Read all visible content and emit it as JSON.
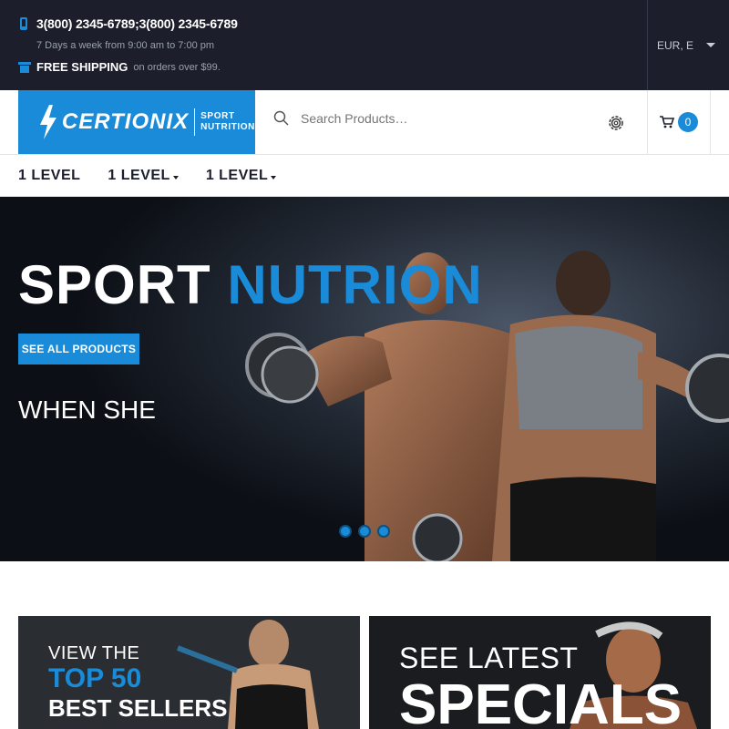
{
  "topbar": {
    "phone": "3(800) 2345-6789;3(800) 2345-6789",
    "hours": "7 Days a week from 9:00 am to 7:00 pm",
    "shipping_label": "FREE SHIPPING",
    "shipping_note": "on orders over $99.",
    "currency": "EUR, E"
  },
  "header": {
    "brand": "CERTIONIX",
    "tagline_1": "SPORT",
    "tagline_2": "NUTRITION",
    "search_placeholder": "Search Products…",
    "cart_count": "0"
  },
  "nav": {
    "items": [
      {
        "label": "1 LEVEL"
      },
      {
        "label": "1 LEVEL"
      },
      {
        "label": "1 LEVEL"
      }
    ]
  },
  "hero": {
    "title_white": "SPORT",
    "title_accent": "NUTRION",
    "cta": "SEE ALL PRODUCTS",
    "subtitle": "WHEN SHE"
  },
  "promos": {
    "left": {
      "line1": "VIEW THE",
      "line2": "TOP 50",
      "line3": "BEST SELLERS"
    },
    "right": {
      "line1": "SEE LATEST",
      "line2": "SPECIALS"
    }
  },
  "colors": {
    "accent": "#1a8bd8",
    "topbar_bg": "#1c1f2b"
  },
  "icons": [
    "phone-icon",
    "shipping-icon",
    "search-icon",
    "settings-icon",
    "cart-icon",
    "bolt-logo-icon"
  ]
}
